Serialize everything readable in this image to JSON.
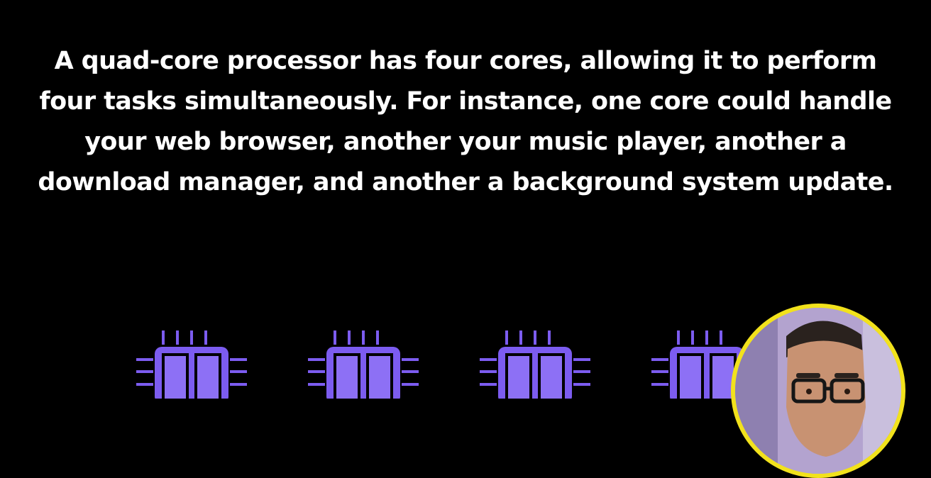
{
  "caption": {
    "text": "A quad-core processor has four cores, allowing it to perform four tasks simultaneously. For instance, one core could handle your web browser, another your music player, another a download manager, and another a background system update."
  },
  "chips": [
    {
      "icon": "cpu-chip-icon"
    },
    {
      "icon": "cpu-chip-icon"
    },
    {
      "icon": "cpu-chip-icon"
    },
    {
      "icon": "cpu-chip-icon"
    }
  ],
  "webcam": {
    "icon": "presenter-avatar",
    "border_color": "#f2e21c"
  },
  "colors": {
    "background": "#000000",
    "text": "#ffffff",
    "chip_accent": "#7c5cf0"
  }
}
